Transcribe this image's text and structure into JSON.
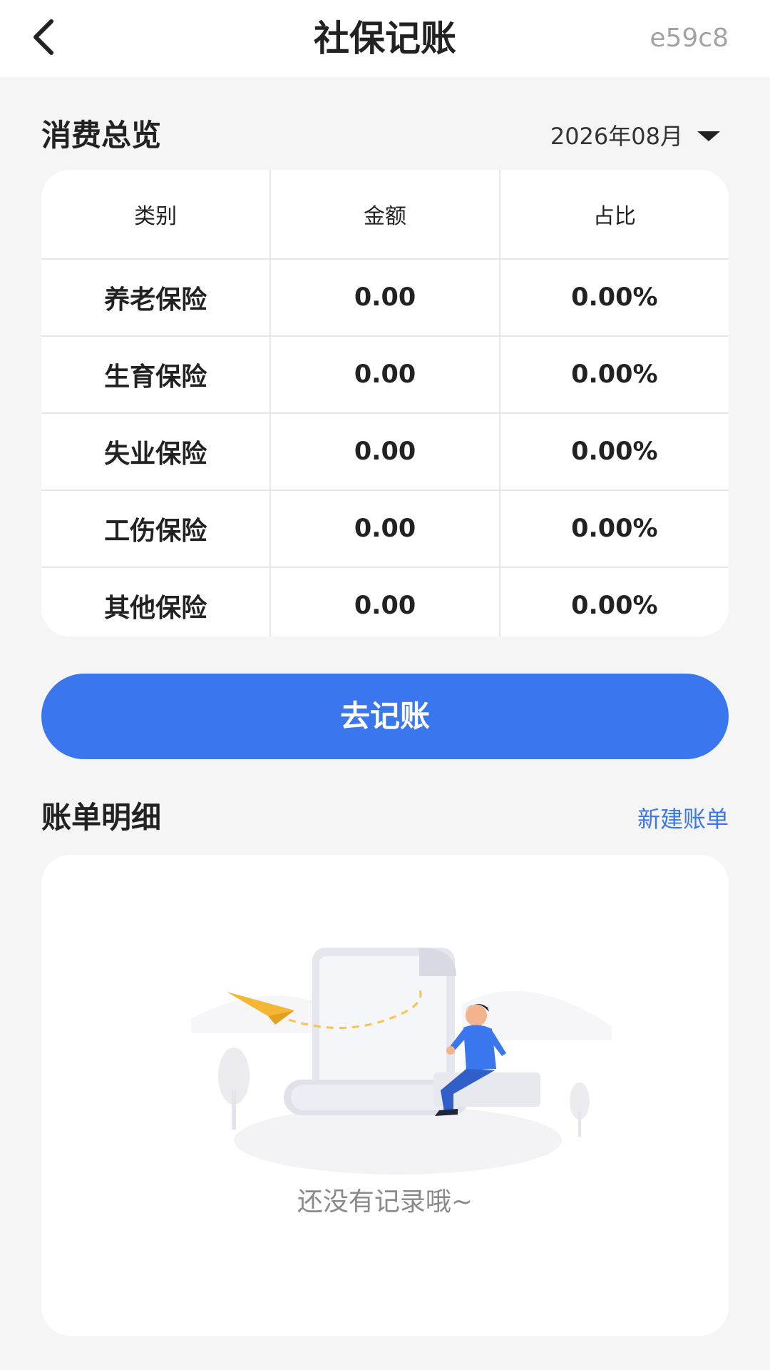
{
  "header": {
    "title": "社保记账",
    "code": "e59c8",
    "back_icon": "chevron-left-icon"
  },
  "overview": {
    "title": "消费总览",
    "month": "2026年08月",
    "month_icon": "caret-down-icon",
    "columns": [
      "类别",
      "金额",
      "占比"
    ],
    "rows": [
      {
        "category": "养老保险",
        "amount": "0.00",
        "ratio": "0.00%"
      },
      {
        "category": "生育保险",
        "amount": "0.00",
        "ratio": "0.00%"
      },
      {
        "category": "失业保险",
        "amount": "0.00",
        "ratio": "0.00%"
      },
      {
        "category": "工伤保险",
        "amount": "0.00",
        "ratio": "0.00%"
      },
      {
        "category": "其他保险",
        "amount": "0.00",
        "ratio": "0.00%"
      }
    ]
  },
  "actions": {
    "go_label": "去记账"
  },
  "bills": {
    "title": "账单明细",
    "new_label": "新建账单",
    "empty_text": "还没有记录哦~",
    "empty_illustration": "empty-records-illustration"
  },
  "colors": {
    "accent": "#3a77ef",
    "background": "#f5f5f5",
    "card": "#ffffff"
  }
}
